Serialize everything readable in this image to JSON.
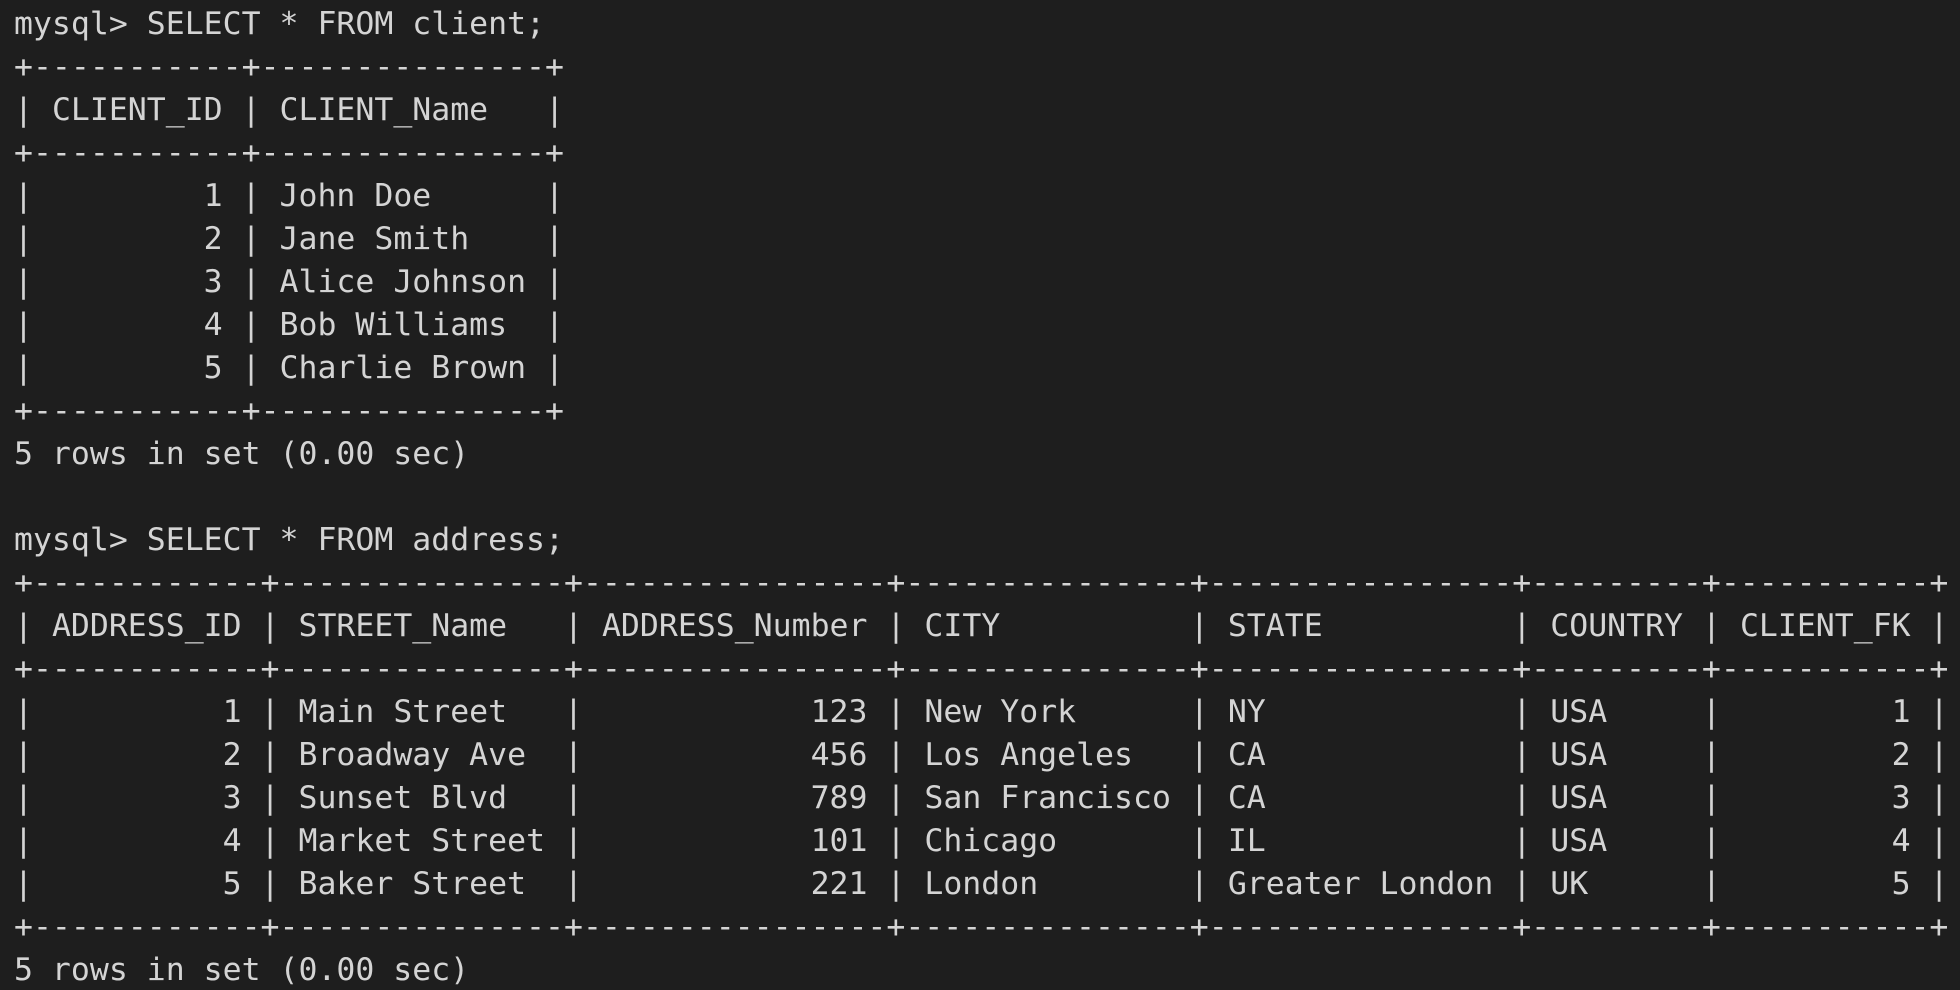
{
  "terminal": {
    "prompt": "mysql>",
    "blocks": [
      {
        "command": "SELECT * FROM client;",
        "columns": [
          {
            "name": "CLIENT_ID",
            "align": "right"
          },
          {
            "name": "CLIENT_Name",
            "align": "left"
          }
        ],
        "rows": [
          [
            "1",
            "John Doe"
          ],
          [
            "2",
            "Jane Smith"
          ],
          [
            "3",
            "Alice Johnson"
          ],
          [
            "4",
            "Bob Williams"
          ],
          [
            "5",
            "Charlie Brown"
          ]
        ],
        "footer": "5 rows in set (0.00 sec)"
      },
      {
        "command": "SELECT * FROM address;",
        "columns": [
          {
            "name": "ADDRESS_ID",
            "align": "right"
          },
          {
            "name": "STREET_Name",
            "align": "left"
          },
          {
            "name": "ADDRESS_Number",
            "align": "right"
          },
          {
            "name": "CITY",
            "align": "left"
          },
          {
            "name": "STATE",
            "align": "left"
          },
          {
            "name": "COUNTRY",
            "align": "left"
          },
          {
            "name": "CLIENT_FK",
            "align": "right"
          }
        ],
        "rows": [
          [
            "1",
            "Main Street",
            "123",
            "New York",
            "NY",
            "USA",
            "1"
          ],
          [
            "2",
            "Broadway Ave",
            "456",
            "Los Angeles",
            "CA",
            "USA",
            "2"
          ],
          [
            "3",
            "Sunset Blvd",
            "789",
            "San Francisco",
            "CA",
            "USA",
            "3"
          ],
          [
            "4",
            "Market Street",
            "101",
            "Chicago",
            "IL",
            "USA",
            "4"
          ],
          [
            "5",
            "Baker Street",
            "221",
            "London",
            "Greater London",
            "UK",
            "5"
          ]
        ],
        "footer": "5 rows in set (0.00 sec)"
      }
    ]
  }
}
